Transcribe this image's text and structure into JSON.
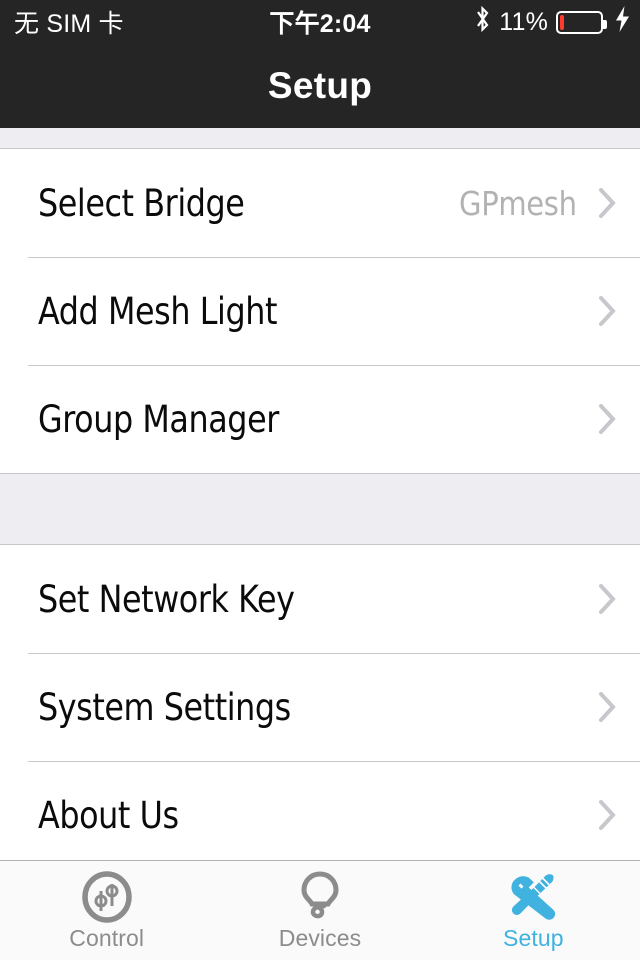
{
  "statusbar": {
    "carrier": "无 SIM 卡",
    "time": "下午2:04",
    "bluetooth_icon": "bluetooth-icon",
    "battery_percent": "11%",
    "battery_level": 11,
    "battery_fill_color": "#FF3B30",
    "charging_icon": "lightning-bolt-icon"
  },
  "navbar": {
    "title": "Setup",
    "background": "#252525"
  },
  "sections": [
    {
      "id": "mesh-section",
      "rows": [
        {
          "label": "Select Bridge",
          "value": "GPmesh",
          "accessory": "chevron-right-icon"
        },
        {
          "label": "Add Mesh Light",
          "value": "",
          "accessory": "chevron-right-icon"
        },
        {
          "label": "Group Manager",
          "value": "",
          "accessory": "chevron-right-icon"
        }
      ]
    },
    {
      "id": "system-section",
      "rows": [
        {
          "label": "Set Network Key",
          "value": "",
          "accessory": "chevron-right-icon"
        },
        {
          "label": "System Settings",
          "value": "",
          "accessory": "chevron-right-icon"
        },
        {
          "label": "About Us",
          "value": "",
          "accessory": "chevron-right-icon"
        }
      ]
    }
  ],
  "tabbar": {
    "active_color": "#3FB2E0",
    "inactive_color": "#8C8C8C",
    "tabs": [
      {
        "label": "Control",
        "icon": "sliders-circle-icon",
        "active": false
      },
      {
        "label": "Devices",
        "icon": "light-bulb-icon",
        "active": false
      },
      {
        "label": "Setup",
        "icon": "wrench-screwdriver-icon",
        "active": true
      }
    ]
  }
}
